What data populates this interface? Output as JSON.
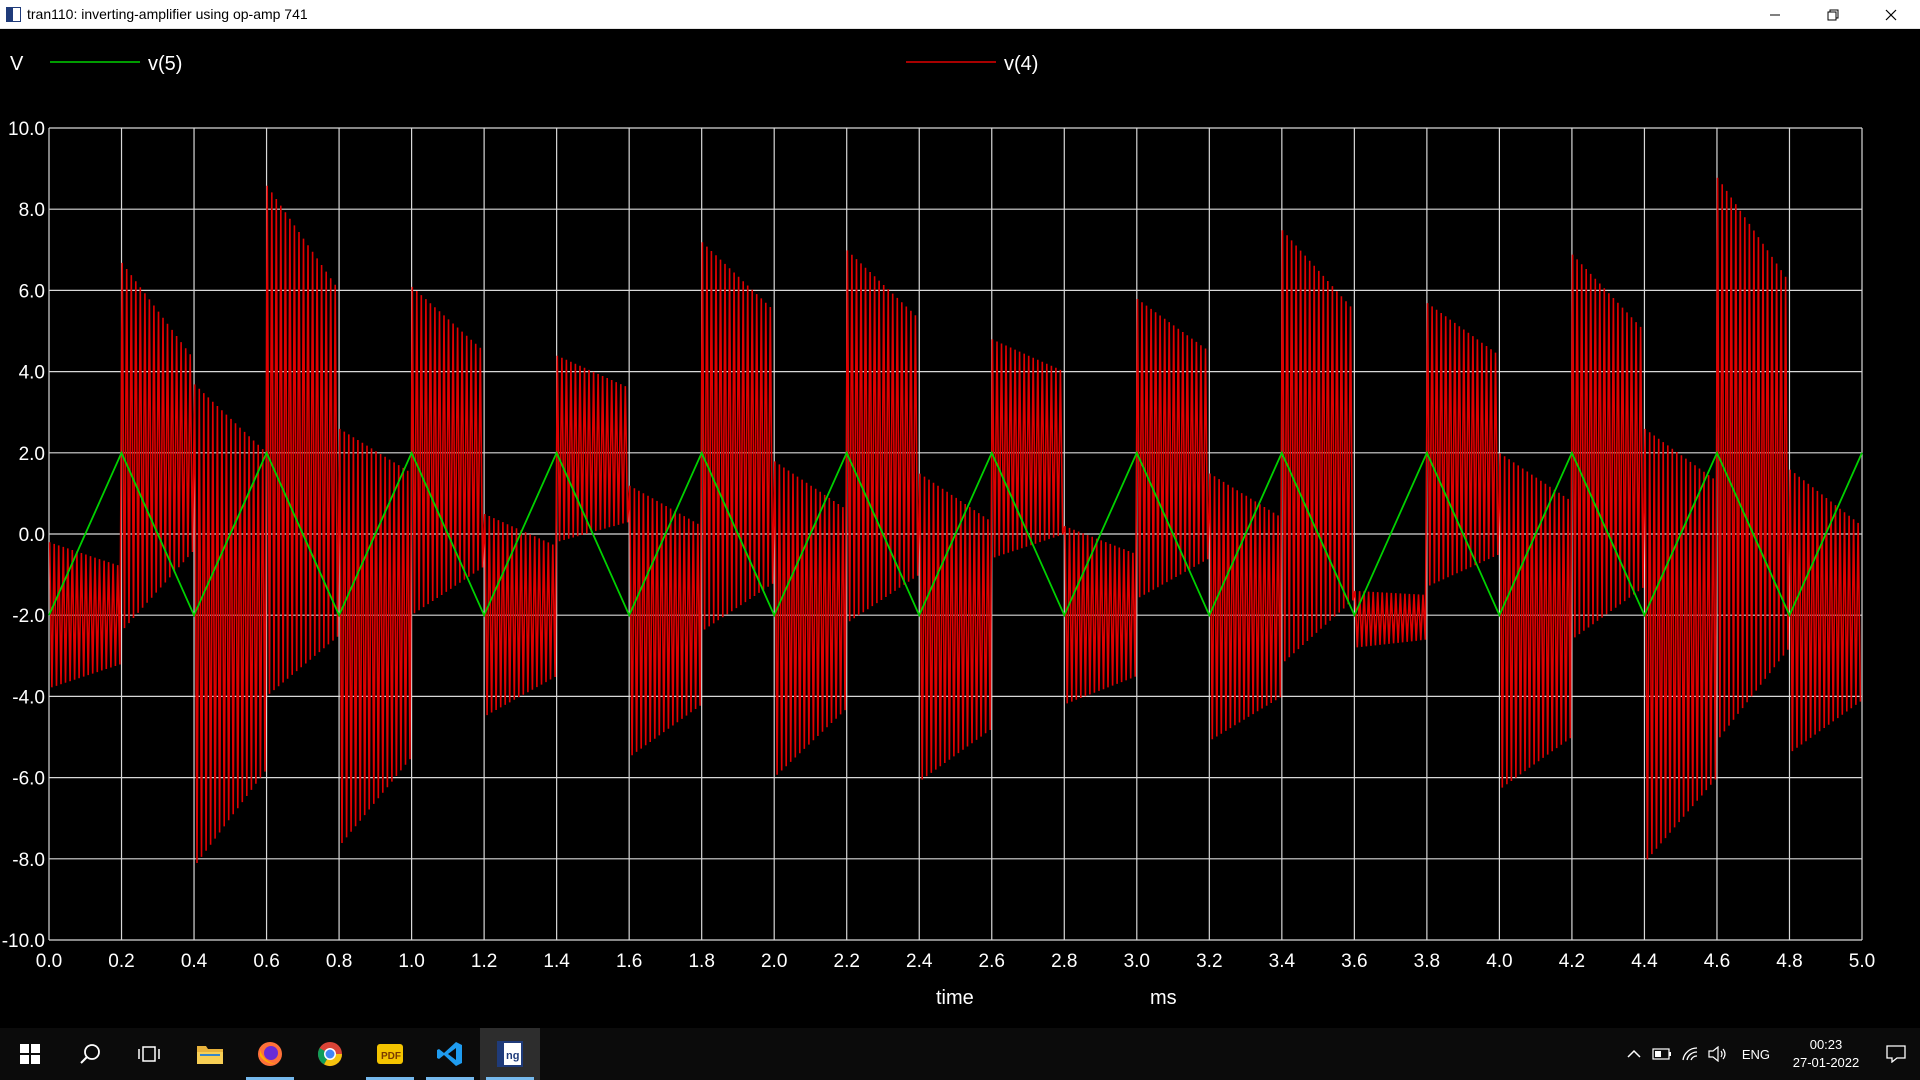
{
  "window": {
    "title": "tran110: inverting-amplifier using op-amp 741"
  },
  "plot": {
    "y_unit_label": "V",
    "legend": [
      {
        "name": "v(5)",
        "color": "#00d000"
      },
      {
        "name": "v(4)",
        "color": "#e00000"
      }
    ],
    "x_axis_label": "time",
    "x_axis_unit": "ms",
    "y_ticks": [
      "10.0",
      "8.0",
      "6.0",
      "4.0",
      "2.0",
      "0.0",
      "-2.0",
      "-4.0",
      "-6.0",
      "-8.0",
      "-10.0"
    ],
    "x_ticks": [
      "0.0",
      "0.2",
      "0.4",
      "0.6",
      "0.8",
      "1.0",
      "1.2",
      "1.4",
      "1.6",
      "1.8",
      "2.0",
      "2.2",
      "2.4",
      "2.6",
      "2.8",
      "3.0",
      "3.2",
      "3.4",
      "3.6",
      "3.8",
      "4.0",
      "4.2",
      "4.4",
      "4.6",
      "4.8",
      "5.0"
    ]
  },
  "chart_data": {
    "type": "line",
    "xlabel": "time",
    "x_unit": "ms",
    "ylabel": "V",
    "xlim": [
      0,
      5.0
    ],
    "ylim": [
      -10,
      10
    ],
    "grid": true,
    "legend_position": "top",
    "series": [
      {
        "name": "v(5)",
        "color": "#00d000",
        "x": [
          0,
          0.2,
          0.4,
          0.6,
          0.8,
          1.0,
          1.2,
          1.4,
          1.6,
          1.8,
          2.0,
          2.2,
          2.4,
          2.6,
          2.8,
          3.0,
          3.2,
          3.4,
          3.6,
          3.8,
          4.0,
          4.2,
          4.4,
          4.6,
          4.8,
          5.0
        ],
        "y": [
          -2,
          2,
          -2,
          2,
          -2,
          2,
          -2,
          2,
          -2,
          2,
          -2,
          2,
          -2,
          2,
          -2,
          2,
          -2,
          2,
          -2,
          2,
          -2,
          2,
          -2,
          2,
          -2,
          2
        ]
      },
      {
        "name": "v(4)",
        "color": "#e00000",
        "segments": [
          {
            "x0": 0.0,
            "x1": 0.2,
            "hi_start": -0.2,
            "hi_end": -0.8,
            "lo_start": -3.8,
            "lo_end": -3.2
          },
          {
            "x0": 0.2,
            "x1": 0.4,
            "hi_start": 6.7,
            "hi_end": 4.3,
            "lo_start": -2.4,
            "lo_end": -0.4
          },
          {
            "x0": 0.4,
            "x1": 0.6,
            "hi_start": 3.7,
            "hi_end": 2.0,
            "lo_start": -8.2,
            "lo_end": -5.8
          },
          {
            "x0": 0.6,
            "x1": 0.8,
            "hi_start": 8.6,
            "hi_end": 6.0,
            "lo_start": -4.0,
            "lo_end": -2.5
          },
          {
            "x0": 0.8,
            "x1": 1.0,
            "hi_start": 2.6,
            "hi_end": 1.5,
            "lo_start": -7.7,
            "lo_end": -5.5
          },
          {
            "x0": 1.0,
            "x1": 1.2,
            "hi_start": 6.1,
            "hi_end": 4.5,
            "lo_start": -2.0,
            "lo_end": -0.8
          },
          {
            "x0": 1.2,
            "x1": 1.4,
            "hi_start": 0.5,
            "hi_end": -0.3,
            "lo_start": -4.5,
            "lo_end": -3.5
          },
          {
            "x0": 1.4,
            "x1": 1.6,
            "hi_start": 4.4,
            "hi_end": 3.6,
            "lo_start": -0.2,
            "lo_end": 0.3
          },
          {
            "x0": 1.6,
            "x1": 1.8,
            "hi_start": 1.2,
            "hi_end": 0.2,
            "lo_start": -5.5,
            "lo_end": -4.2
          },
          {
            "x0": 1.8,
            "x1": 2.0,
            "hi_start": 7.2,
            "hi_end": 5.5,
            "lo_start": -2.4,
            "lo_end": -1.2
          },
          {
            "x0": 2.0,
            "x1": 2.2,
            "hi_start": 1.8,
            "hi_end": 0.6,
            "lo_start": -6.0,
            "lo_end": -4.3
          },
          {
            "x0": 2.2,
            "x1": 2.4,
            "hi_start": 7.0,
            "hi_end": 5.3,
            "lo_start": -2.2,
            "lo_end": -1.0
          },
          {
            "x0": 2.4,
            "x1": 2.6,
            "hi_start": 1.5,
            "hi_end": 0.3,
            "lo_start": -6.1,
            "lo_end": -4.8
          },
          {
            "x0": 2.6,
            "x1": 2.8,
            "hi_start": 4.8,
            "hi_end": 4.0,
            "lo_start": -0.6,
            "lo_end": 0.0
          },
          {
            "x0": 2.8,
            "x1": 3.0,
            "hi_start": 0.2,
            "hi_end": -0.5,
            "lo_start": -4.2,
            "lo_end": -3.5
          },
          {
            "x0": 3.0,
            "x1": 3.2,
            "hi_start": 5.8,
            "hi_end": 4.5,
            "lo_start": -1.6,
            "lo_end": -0.6
          },
          {
            "x0": 3.2,
            "x1": 3.4,
            "hi_start": 1.5,
            "hi_end": 0.4,
            "lo_start": -5.1,
            "lo_end": -4.0
          },
          {
            "x0": 3.4,
            "x1": 3.6,
            "hi_start": 7.5,
            "hi_end": 5.5,
            "lo_start": -3.2,
            "lo_end": -1.6
          },
          {
            "x0": 3.6,
            "x1": 3.8,
            "hi_start": -1.4,
            "hi_end": -1.5,
            "lo_start": -2.8,
            "lo_end": -2.6
          },
          {
            "x0": 3.8,
            "x1": 4.0,
            "hi_start": 5.7,
            "hi_end": 4.4,
            "lo_start": -1.3,
            "lo_end": -0.5
          },
          {
            "x0": 4.0,
            "x1": 4.2,
            "hi_start": 2.0,
            "hi_end": 0.8,
            "lo_start": -6.3,
            "lo_end": -5.0
          },
          {
            "x0": 4.2,
            "x1": 4.4,
            "hi_start": 6.9,
            "hi_end": 5.0,
            "lo_start": -2.6,
            "lo_end": -1.3
          },
          {
            "x0": 4.4,
            "x1": 4.6,
            "hi_start": 2.6,
            "hi_end": 1.3,
            "lo_start": -8.1,
            "lo_end": -6.0
          },
          {
            "x0": 4.6,
            "x1": 4.8,
            "hi_start": 8.8,
            "hi_end": 6.2,
            "lo_start": -5.1,
            "lo_end": -2.8
          },
          {
            "x0": 4.8,
            "x1": 5.0,
            "hi_start": 1.6,
            "hi_end": 0.2,
            "lo_start": -5.4,
            "lo_end": -4.1
          }
        ]
      }
    ]
  },
  "taskbar": {
    "items": [
      {
        "name": "start-button",
        "icon": "windows-logo-icon"
      },
      {
        "name": "search-button",
        "icon": "search-icon"
      },
      {
        "name": "task-view-button",
        "icon": "task-view-icon"
      },
      {
        "name": "file-explorer",
        "icon": "folder-icon"
      },
      {
        "name": "firefox",
        "icon": "firefox-icon"
      },
      {
        "name": "chrome",
        "icon": "chrome-icon"
      },
      {
        "name": "pdf-reader",
        "icon": "pdf-icon"
      },
      {
        "name": "vscode",
        "icon": "vscode-icon"
      },
      {
        "name": "ngspice",
        "icon": "ngspice-icon"
      }
    ],
    "tray": {
      "language": "ENG",
      "time": "00:23",
      "date": "27-01-2022"
    }
  }
}
